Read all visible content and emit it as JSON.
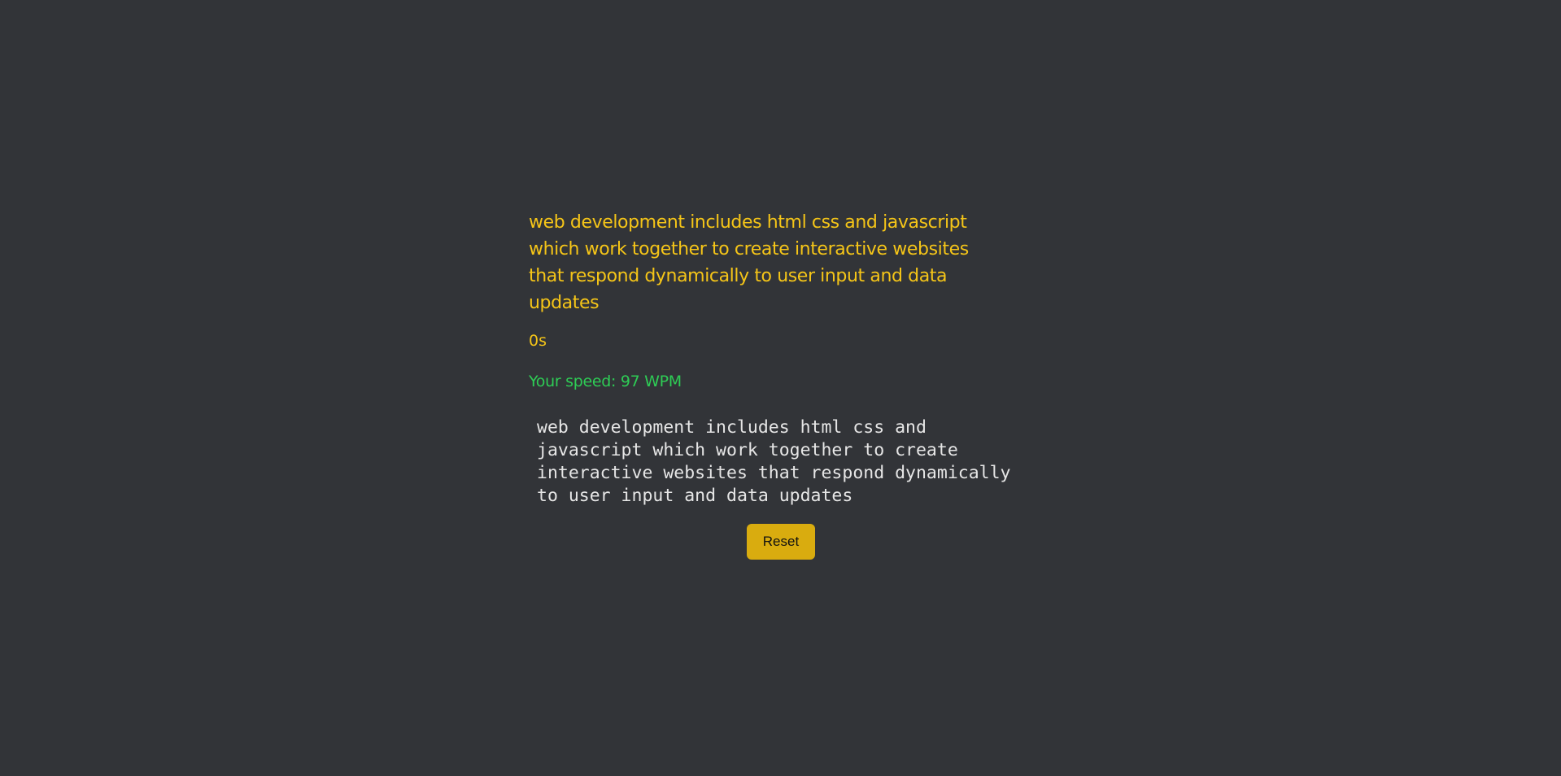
{
  "typing_test": {
    "prompt": "web development includes html css and javascript which work together to create interactive websites that respond dynamically to user input and data updates",
    "timer": "0s",
    "speed": "Your speed: 97 WPM",
    "input_value": "web development includes html css and javascript which work together to create interactive websites that respond dynamically to user input and data updates",
    "reset_label": "Reset"
  },
  "colors": {
    "background": "#323438",
    "prompt": "#f5c518",
    "speed": "#2ecc55",
    "button": "#d9ac0f"
  }
}
